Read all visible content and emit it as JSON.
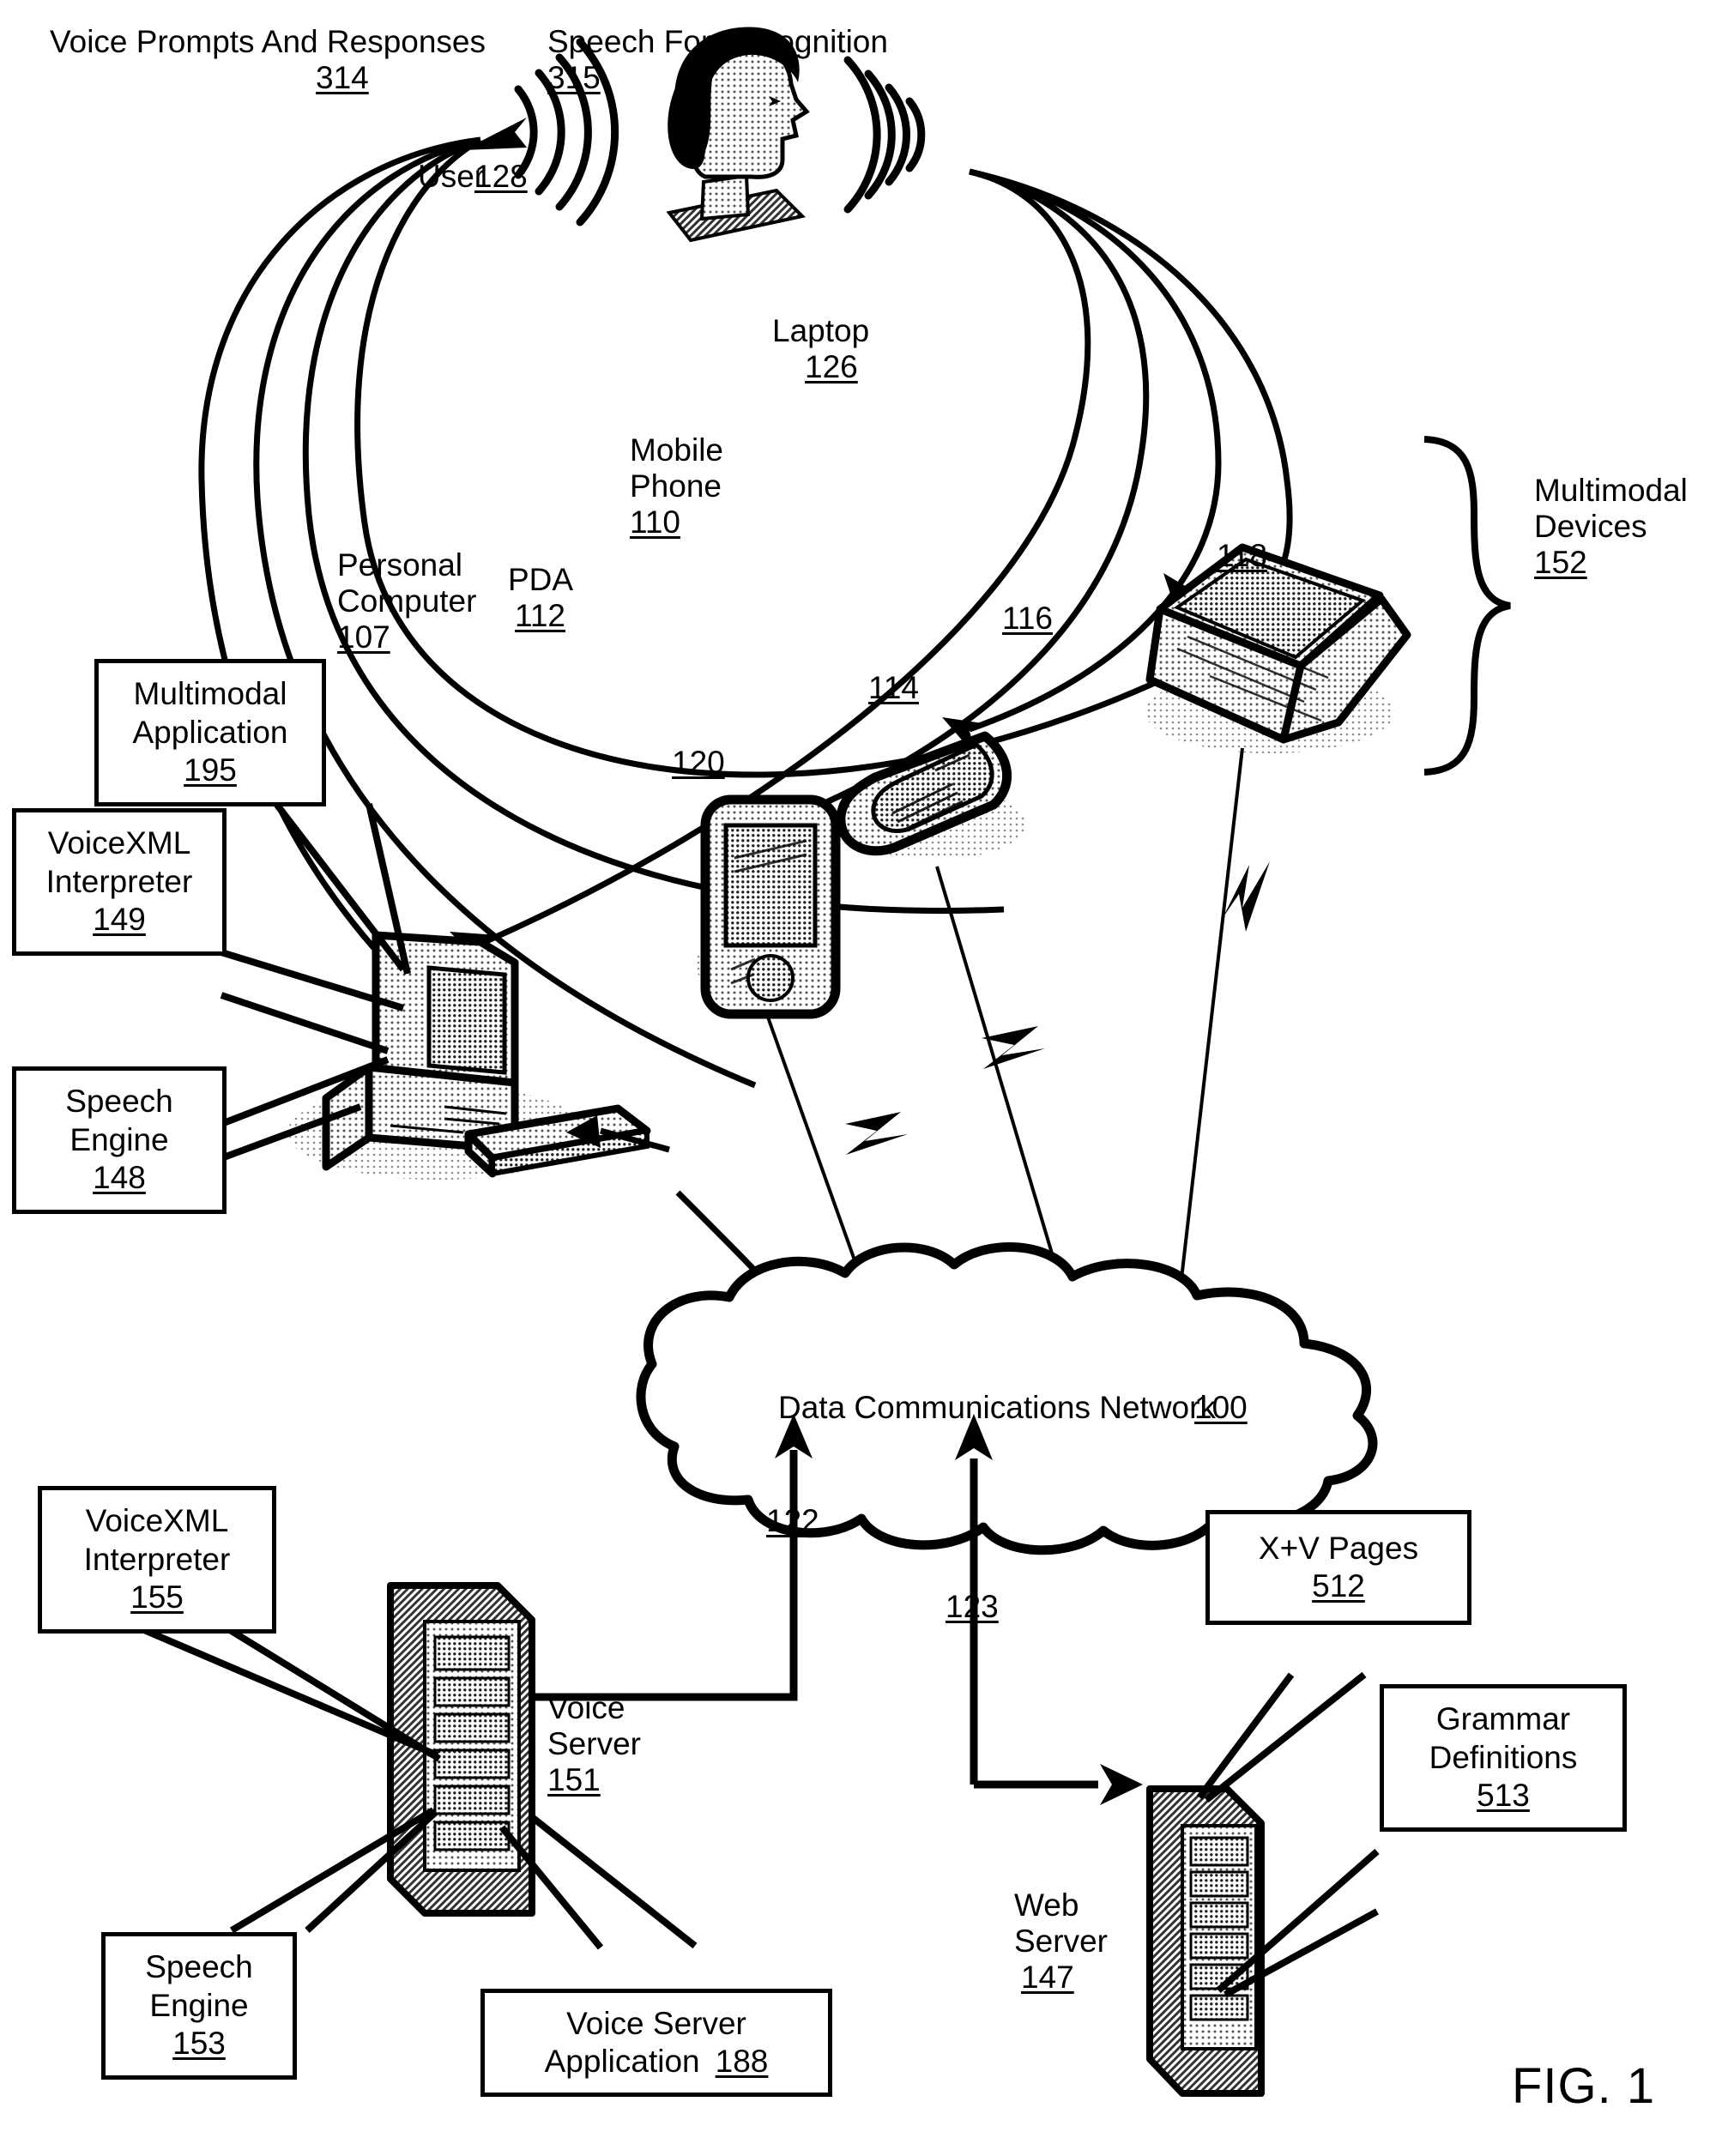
{
  "figure": {
    "caption": "FIG. 1"
  },
  "annotations": {
    "voice_prompts": {
      "text": "Voice Prompts And Responses",
      "ref": "314"
    },
    "speech_recognition": {
      "text": "Speech For Recognition",
      "ref": "315"
    },
    "user": {
      "text": "User",
      "ref": "128"
    },
    "multimodal_devices": {
      "line1": "Multimodal",
      "line2": "Devices",
      "ref": "152"
    },
    "network": {
      "text": "Data Communications Network",
      "ref": "100"
    }
  },
  "devices": {
    "laptop": {
      "label": "Laptop",
      "ref": "126"
    },
    "mobile_phone": {
      "line1": "Mobile",
      "line2": "Phone",
      "ref": "110"
    },
    "pda": {
      "label": "PDA",
      "ref": "112"
    },
    "personal_computer": {
      "line1": "Personal",
      "line2": "Computer",
      "ref": "107"
    },
    "voice_server": {
      "line1": "Voice",
      "line2": "Server",
      "ref": "151"
    },
    "web_server": {
      "line1": "Web",
      "line2": "Server",
      "ref": "147"
    }
  },
  "links": {
    "pc_to_network": "120",
    "pda_to_network": "114",
    "phone_to_network": "116",
    "laptop_to_network": "118",
    "network_to_voice_server": "122",
    "network_to_web_server": "123"
  },
  "callouts": [
    {
      "id": "multimodal-application",
      "line1": "Multimodal",
      "line2": "Application",
      "ref": "195"
    },
    {
      "id": "voicexml-interpreter-149",
      "line1": "VoiceXML",
      "line2": "Interpreter",
      "ref": "149"
    },
    {
      "id": "speech-engine-148",
      "line1": "Speech",
      "line2": "Engine",
      "ref": "148"
    },
    {
      "id": "voicexml-interpreter-155",
      "line1": "VoiceXML",
      "line2": "Interpreter",
      "ref": "155"
    },
    {
      "id": "speech-engine-153",
      "line1": "Speech",
      "line2": "Engine",
      "ref": "153"
    },
    {
      "id": "voice-server-application",
      "line1": "Voice Server",
      "line2": "Application",
      "ref": "188",
      "inline": true
    },
    {
      "id": "xv-pages",
      "line1": "X+V Pages",
      "line2": "",
      "ref": "512"
    },
    {
      "id": "grammar-definitions",
      "line1": "Grammar",
      "line2": "Definitions",
      "ref": "513"
    }
  ],
  "colors": {
    "ink": "#000000",
    "paper": "#ffffff",
    "shade": "#bdbdbd",
    "shade_light": "#dcdcdc"
  }
}
